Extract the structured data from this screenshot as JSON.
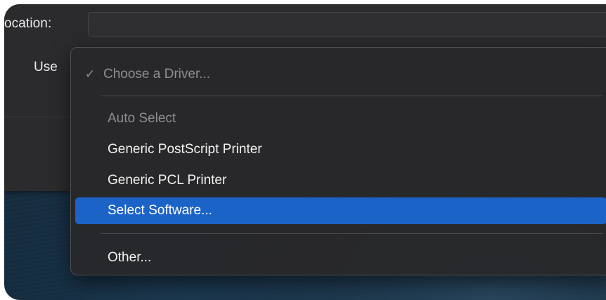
{
  "location": {
    "label": "ocation:",
    "value": ""
  },
  "driver": {
    "use_label": "Use",
    "menu": {
      "check_mark": "✓",
      "items": [
        {
          "label": "Choose a Driver...",
          "checked": true,
          "enabled": false
        },
        {
          "label": "Auto Select",
          "enabled": false
        },
        {
          "label": "Generic PostScript Printer",
          "enabled": true
        },
        {
          "label": "Generic PCL Printer",
          "enabled": true
        },
        {
          "label": "Select Software...",
          "enabled": true,
          "highlighted": true
        },
        {
          "label": "Other...",
          "enabled": true
        }
      ]
    }
  },
  "colors": {
    "highlight": "#1c63c8",
    "menu_bg": "#28282a",
    "disabled_text": "#8e8e90"
  }
}
